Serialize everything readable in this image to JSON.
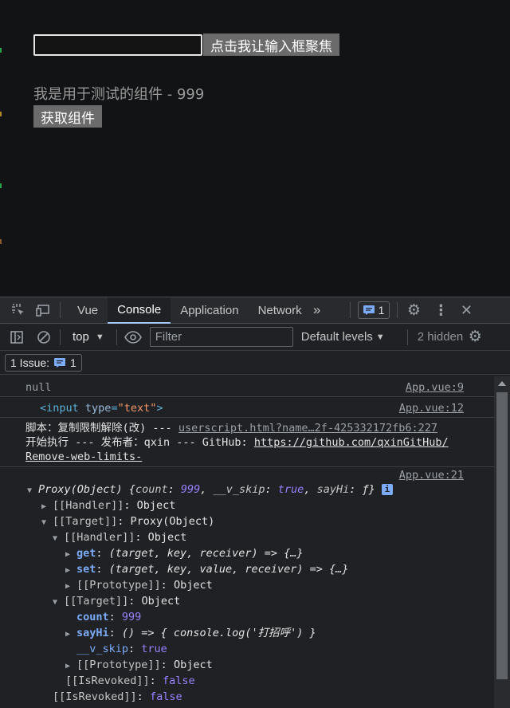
{
  "page": {
    "focus_button": "点击我让输入框聚焦",
    "component_text": "我是用于测试的组件 - 999",
    "get_button": "获取组件"
  },
  "devtools": {
    "tabs": [
      "Vue",
      "Console",
      "Application",
      "Network"
    ],
    "active_tab": "Console",
    "more_tabs_icon": "chevron-double-right-icon",
    "message_count": "1",
    "context": "top",
    "filter_placeholder": "Filter",
    "levels": "Default levels",
    "hidden": "2 hidden",
    "issues_label": "1 Issue:",
    "issues_count": "1"
  },
  "console": {
    "null_text": "null",
    "null_src": "App.vue:9",
    "input_src": "App.vue:12",
    "input_tag": "<input",
    "input_attr": "type",
    "input_eq": "=",
    "input_val": "\"text\"",
    "input_close": ">",
    "script_line1": "脚本：复制限制解除(改) --- ",
    "script_src": "userscript.html?name…2f-425332172fb6:227",
    "script_line2": "开始执行 --- 发布者：qxin --- GitHub: ",
    "script_link1": "https://github.com/qxinGitHub/",
    "script_link2": "Remove-web-limits-",
    "proxy_src": "App.vue:21",
    "proxy_head": "Proxy(Object) ",
    "proxy_preview_open": "{",
    "proxy_count_key": "count",
    "proxy_count_val": "999",
    "proxy_skip_key": "__v_skip",
    "proxy_skip_val": "true",
    "proxy_sayhi_key": "sayHi",
    "proxy_sayhi_val": "ƒ",
    "proxy_preview_close": "}",
    "handler_label": "[[Handler]]",
    "object_label": "Object",
    "target_label": "[[Target]]",
    "target_value": "Proxy(Object)",
    "get_key": "get",
    "get_val": "(target, key, receiver) => {…}",
    "set_key": "set",
    "set_val": "(target, key, value, receiver) => {…}",
    "prototype_label": "[[Prototype]]",
    "count_key": "count",
    "count_val": "999",
    "sayhi_key": "sayHi",
    "sayhi_val": "() => { console.log('打招呼') }",
    "vskip_key": "__v_skip",
    "vskip_val": "true",
    "revoked_label": "[[IsRevoked]]",
    "revoked_val": "false"
  },
  "colors": {
    "page_bg": "#121314",
    "devtools_bg": "#202124",
    "accent": "#a8c7fa",
    "number": "#9980ff"
  }
}
